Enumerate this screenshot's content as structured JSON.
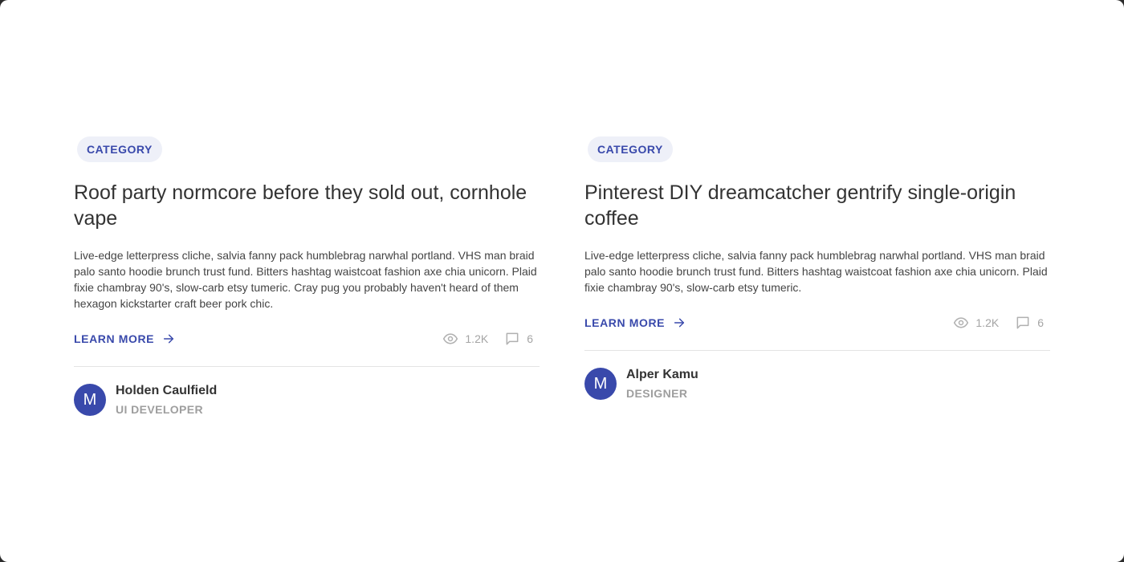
{
  "cards": [
    {
      "category": "CATEGORY",
      "title": "Roof party normcore before they sold out, cornhole vape",
      "description": "Live-edge letterpress cliche, salvia fanny pack humblebrag narwhal portland. VHS man braid palo santo hoodie brunch trust fund. Bitters hashtag waistcoat fashion axe chia unicorn. Plaid fixie chambray 90's, slow-carb etsy tumeric. Cray pug you probably haven't heard of them hexagon kickstarter craft beer pork chic.",
      "learn_more": "LEARN MORE",
      "views": "1.2K",
      "comments": "6",
      "author": {
        "initial": "M",
        "name": "Holden Caulfield",
        "role": "UI DEVELOPER"
      }
    },
    {
      "category": "CATEGORY",
      "title": "Pinterest DIY dreamcatcher gentrify single-origin coffee",
      "description": "Live-edge letterpress cliche, salvia fanny pack humblebrag narwhal portland. VHS man braid palo santo hoodie brunch trust fund. Bitters hashtag waistcoat fashion axe chia unicorn. Plaid fixie chambray 90's, slow-carb etsy tumeric.",
      "learn_more": "LEARN MORE",
      "views": "1.2K",
      "comments": "6",
      "author": {
        "initial": "M",
        "name": "Alper Kamu",
        "role": "DESIGNER"
      }
    }
  ],
  "icons": {
    "arrow": "arrow-right-icon",
    "views": "eye-icon",
    "comments": "comment-icon"
  },
  "colors": {
    "accent": "#3949ab",
    "badge_bg": "#eef0f8",
    "muted": "#a5a5a5"
  }
}
